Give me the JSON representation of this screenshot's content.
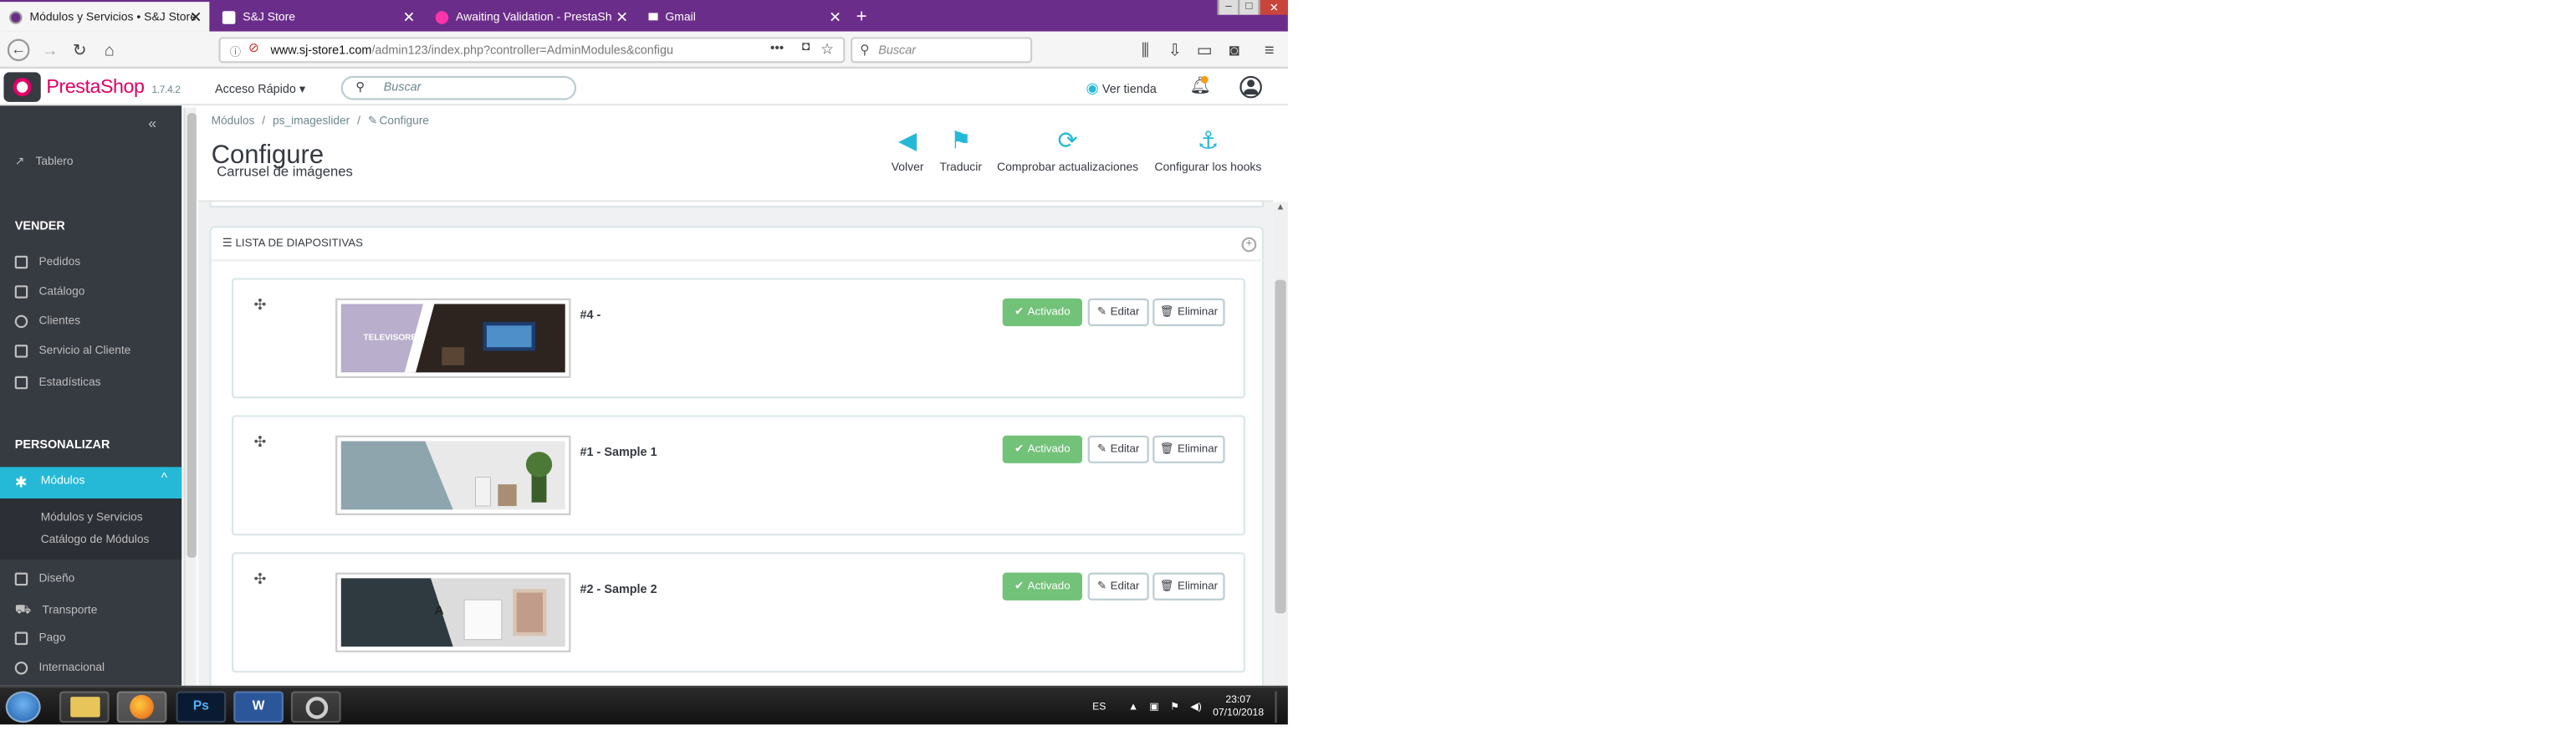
{
  "browser": {
    "tabs": [
      {
        "label": "Módulos y Servicios • S&J Store",
        "active": true
      },
      {
        "label": "S&J Store",
        "active": false
      },
      {
        "label": "Awaiting Validation - PrestaSh",
        "active": false
      },
      {
        "label": "Gmail",
        "active": false
      }
    ],
    "new_tab": "+",
    "close_glyph": "✕",
    "url_host": "www.sj-store1.com",
    "url_path": "/admin123/index.php?controller=AdminModules&configu",
    "search_placeholder": "Buscar"
  },
  "header": {
    "logo_text": "PrestaShop",
    "version": "1.7.4.2",
    "quick_access": "Acceso Rápido ▾",
    "search_placeholder": "Buscar",
    "view_store": "Ver tienda"
  },
  "sidebar": {
    "collapse": "«",
    "dashboard": "Tablero",
    "section_sell": "VENDER",
    "sell_items": [
      "Pedidos",
      "Catálogo",
      "Clientes",
      "Servicio al Cliente",
      "Estadísticas"
    ],
    "section_customize": "PERSONALIZAR",
    "active_item": "Módulos",
    "sub_items": [
      "Módulos y Servicios",
      "Catálogo de Módulos"
    ],
    "more_items": [
      "Diseño",
      "Transporte",
      "Pago",
      "Internacional"
    ]
  },
  "toolbar": {
    "breadcrumb": [
      "Módulos",
      "/",
      "ps_imageslider",
      "/",
      "Configure"
    ],
    "title": "Configure",
    "subtitle": "Carrusel de imágenes",
    "buttons": [
      "Volver",
      "Traducir",
      "Comprobar actualizaciones",
      "Configurar los hooks"
    ]
  },
  "panel": {
    "heading": "LISTA DE DIAPOSITIVAS",
    "slides": [
      {
        "title": "#4 -",
        "banner_text": "TELEVISORES"
      },
      {
        "title": "#1 - Sample 1"
      },
      {
        "title": "#2 - Sample 2"
      }
    ],
    "status_label": "Activado",
    "edit_label": "Editar",
    "delete_label": "Eliminar"
  },
  "taskbar": {
    "lang": "ES",
    "time": "23:07",
    "date": "07/10/2018",
    "apps": [
      "Ps",
      "W"
    ]
  }
}
